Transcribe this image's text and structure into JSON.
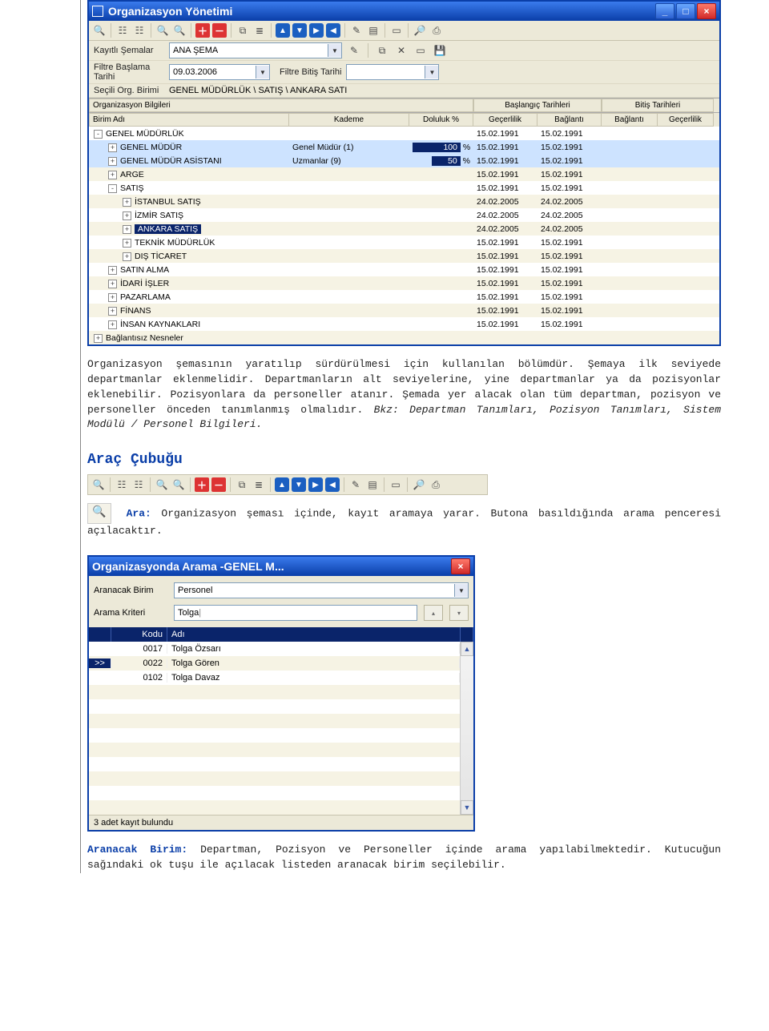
{
  "win1": {
    "title": "Organizasyon Yönetimi",
    "form": {
      "schema_lbl": "Kayıtlı Şemalar",
      "schema_val": "ANA ŞEMA",
      "start_lbl": "Filtre Başlama Tarihi",
      "start_val": "09.03.2006",
      "end_lbl": "Filtre Bitiş Tarihi",
      "end_val": "",
      "selunit_lbl": "Seçili Org. Birimi",
      "selunit_val": "GENEL MÜDÜRLÜK \\ SATIŞ \\ ANKARA SATI"
    },
    "grid": {
      "groups": {
        "org": "Organizasyon Bilgileri",
        "start": "Başlangıç Tarihleri",
        "end": "Bitiş Tarihleri"
      },
      "cols": {
        "name": "Birim Adı",
        "kademe": "Kademe",
        "dol": "Doluluk %",
        "gec": "Geçerlilik",
        "bag": "Bağlantı",
        "bag2": "Bağlantı",
        "gec2": "Geçerlilik"
      },
      "rows": [
        {
          "ind": 0,
          "exp": "-",
          "name": "GENEL MÜDÜRLÜK",
          "kad": "",
          "dol": "",
          "g": "15.02.1991",
          "b": "15.02.1991",
          "hl": false,
          "sel": false
        },
        {
          "ind": 1,
          "exp": "+",
          "name": "GENEL MÜDÜR",
          "kad": "Genel Müdür (1)",
          "dol": "100",
          "dolbarW": 52,
          "g": "15.02.1991",
          "b": "15.02.1991",
          "hl": true,
          "sel": false
        },
        {
          "ind": 1,
          "exp": "+",
          "name": "GENEL MÜDÜR ASİSTANI",
          "kad": "Uzmanlar (9)",
          "dol": "50",
          "dolbarW": 28,
          "g": "15.02.1991",
          "b": "15.02.1991",
          "hl": true,
          "sel": false
        },
        {
          "ind": 1,
          "exp": "+",
          "name": "ARGE",
          "kad": "",
          "dol": "",
          "g": "15.02.1991",
          "b": "15.02.1991",
          "hl": false,
          "sel": false
        },
        {
          "ind": 1,
          "exp": "-",
          "name": "SATIŞ",
          "kad": "",
          "dol": "",
          "g": "15.02.1991",
          "b": "15.02.1991",
          "hl": false,
          "sel": false
        },
        {
          "ind": 2,
          "exp": "+",
          "name": "İSTANBUL SATIŞ",
          "kad": "",
          "dol": "",
          "g": "24.02.2005",
          "b": "24.02.2005",
          "hl": false,
          "sel": false
        },
        {
          "ind": 2,
          "exp": "+",
          "name": "İZMİR SATIŞ",
          "kad": "",
          "dol": "",
          "g": "24.02.2005",
          "b": "24.02.2005",
          "hl": false,
          "sel": false
        },
        {
          "ind": 2,
          "exp": "+",
          "name": "ANKARA SATIŞ",
          "kad": "",
          "dol": "",
          "g": "24.02.2005",
          "b": "24.02.2005",
          "hl": false,
          "sel": true
        },
        {
          "ind": 2,
          "exp": "+",
          "name": "TEKNİK MÜDÜRLÜK",
          "kad": "",
          "dol": "",
          "g": "15.02.1991",
          "b": "15.02.1991",
          "hl": false,
          "sel": false
        },
        {
          "ind": 2,
          "exp": "+",
          "name": "DIŞ TİCARET",
          "kad": "",
          "dol": "",
          "g": "15.02.1991",
          "b": "15.02.1991",
          "hl": false,
          "sel": false
        },
        {
          "ind": 1,
          "exp": "+",
          "name": "SATIN ALMA",
          "kad": "",
          "dol": "",
          "g": "15.02.1991",
          "b": "15.02.1991",
          "hl": false,
          "sel": false
        },
        {
          "ind": 1,
          "exp": "+",
          "name": "İDARİ İŞLER",
          "kad": "",
          "dol": "",
          "g": "15.02.1991",
          "b": "15.02.1991",
          "hl": false,
          "sel": false
        },
        {
          "ind": 1,
          "exp": "+",
          "name": "PAZARLAMA",
          "kad": "",
          "dol": "",
          "g": "15.02.1991",
          "b": "15.02.1991",
          "hl": false,
          "sel": false
        },
        {
          "ind": 1,
          "exp": "+",
          "name": "FİNANS",
          "kad": "",
          "dol": "",
          "g": "15.02.1991",
          "b": "15.02.1991",
          "hl": false,
          "sel": false
        },
        {
          "ind": 1,
          "exp": "+",
          "name": "İNSAN KAYNAKLARI",
          "kad": "",
          "dol": "",
          "g": "15.02.1991",
          "b": "15.02.1991",
          "hl": false,
          "sel": false
        },
        {
          "ind": 0,
          "exp": "+",
          "name": "Bağlantısız Nesneler",
          "kad": "",
          "dol": "",
          "g": "",
          "b": "",
          "hl": false,
          "sel": false
        }
      ]
    }
  },
  "para1_a": "Organizasyon şemasının yaratılıp sürdürülmesi için kullanılan bölümdür. Şemaya ilk seviyede departmanlar eklenmelidir. Departmanların alt seviyelerine, yine departmanlar ya da pozisyonlar eklenebilir. Pozisyonlara da personeller atanır. Şemada yer alacak olan tüm departman, pozisyon ve personeller önceden tanımlanmış olmalıdır. ",
  "para1_b": "Bkz: Departman Tanımları, Pozisyon Tanımları, Sistem Modülü / Personel Bilgileri.",
  "h2": "Araç Çubuğu",
  "ara_lbl": "Ara:",
  "ara_txt": " Organizasyon şeması içinde, kayıt aramaya yarar. Butona basıldığında arama penceresi açılacaktır.",
  "win2": {
    "title": "Organizasyonda Arama -GENEL M...",
    "form": {
      "birim_lbl": "Aranacak Birim",
      "birim_val": "Personel",
      "krit_lbl": "Arama Kriteri",
      "krit_val": "Tolga"
    },
    "cols": {
      "kodu": "Kodu",
      "adi": "Adı"
    },
    "sel_marker": ">>",
    "rows": [
      {
        "k": "0017",
        "a": "Tolga Özsarı",
        "sel": false
      },
      {
        "k": "0022",
        "a": "Tolga Gören",
        "sel": true
      },
      {
        "k": "0102",
        "a": "Tolga Davaz",
        "sel": false
      }
    ],
    "status": "3 adet kayıt bulundu"
  },
  "aranacak_lbl": "Aranacak Birim:",
  "aranacak_txt": " Departman, Pozisyon ve Personeller içinde arama yapılabilmektedir. Kutucuğun sağındaki ok tuşu ile açılacak listeden aranacak birim seçilebilir."
}
